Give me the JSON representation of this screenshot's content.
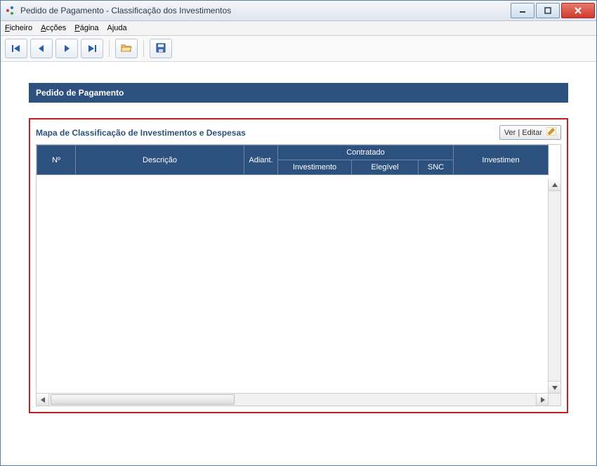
{
  "window": {
    "title": "Pedido de Pagamento - Classificação dos Investimentos"
  },
  "menu": {
    "ficheiro": "Ficheiro",
    "accoes": "Acções",
    "pagina": "Página",
    "ajuda": "Ajuda"
  },
  "panel": {
    "title": "Pedido de Pagamento"
  },
  "section": {
    "title": "Mapa de Classificação de Investimentos e Despesas",
    "ver_editar_label": "Ver | Editar"
  },
  "table": {
    "headers": {
      "numero": "Nº",
      "descricao": "Descrição",
      "adiant": "Adiant.",
      "contratado": "Contratado",
      "investimento": "Investimento",
      "elegivel": "Elegível",
      "snc": "SNC",
      "investimen_overflow": "Investimen"
    },
    "rows": []
  }
}
